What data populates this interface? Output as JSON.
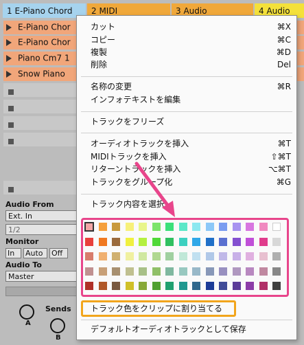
{
  "tracks": [
    {
      "label": "1 E-Piano Chord",
      "color": "#a6d3ee"
    },
    {
      "label": "2 MIDI",
      "color": "#f0a83a"
    },
    {
      "label": "3 Audio",
      "color": "#f0a83a"
    },
    {
      "label": "4 Audio",
      "color": "#f4e13a"
    }
  ],
  "clips": [
    "E-Piano Chor",
    "E-Piano Chor",
    "Piano Cm7 1",
    "Snow Piano"
  ],
  "panel": {
    "audio_from_label": "Audio From",
    "audio_from_value": "Ext. In",
    "input_channel": "1/2",
    "monitor_label": "Monitor",
    "monitor_in": "In",
    "monitor_auto": "Auto",
    "monitor_off": "Off",
    "audio_to_label": "Audio To",
    "audio_to_value": "Master",
    "sends_label": "Sends",
    "send_a": "A",
    "send_b": "B"
  },
  "menu": {
    "items": [
      {
        "label": "カット",
        "shortcut": "⌘X"
      },
      {
        "label": "コピー",
        "shortcut": "⌘C"
      },
      {
        "label": "複製",
        "shortcut": "⌘D"
      },
      {
        "label": "削除",
        "shortcut": "Del"
      },
      {
        "label": "名称の変更",
        "shortcut": "⌘R"
      },
      {
        "label": "インフォテキストを編集",
        "shortcut": ""
      },
      {
        "label": "トラックをフリーズ",
        "shortcut": ""
      },
      {
        "label": "オーディオトラックを挿入",
        "shortcut": "⌘T"
      },
      {
        "label": "MIDIトラックを挿入",
        "shortcut": "⇧⌘T"
      },
      {
        "label": "リターントラックを挿入",
        "shortcut": "⌥⌘T"
      },
      {
        "label": "トラックをグループ化",
        "shortcut": "⌘G"
      },
      {
        "label": "トラック内容を選択",
        "shortcut": ""
      },
      {
        "label": "トラック色をクリップに割り当てる",
        "shortcut": ""
      },
      {
        "label": "デフォルトオーディオトラックとして保存",
        "shortcut": ""
      }
    ],
    "palette": [
      [
        "#f2a6a6",
        "#f5a03c",
        "#c99a3c",
        "#f7f07a",
        "#e8f58a",
        "#7ce46a",
        "#3ce07a",
        "#5ce8c8",
        "#8ce8f0",
        "#8cc8f8",
        "#7a9cf0",
        "#a893f0",
        "#d876e0",
        "#f08ac0",
        "#ffffff"
      ],
      [
        "#e8403c",
        "#f07820",
        "#9a6a3c",
        "#f0f040",
        "#b4f040",
        "#50d838",
        "#30c060",
        "#3cd0c0",
        "#30a8e8",
        "#2070c8",
        "#5a70d0",
        "#8450d0",
        "#c050d8",
        "#e03c8c",
        "#d8d8d8"
      ],
      [
        "#d87c6c",
        "#f0b070",
        "#d0b070",
        "#f0f0a0",
        "#d0e8a0",
        "#b0d890",
        "#a0d0a0",
        "#c0e8d8",
        "#c0e0f0",
        "#b0c8e8",
        "#c0b8e8",
        "#c8b0e8",
        "#e0b0e0",
        "#e8c0d0",
        "#b0b0b0"
      ],
      [
        "#c09090",
        "#c8a078",
        "#a89070",
        "#c0c090",
        "#a8c088",
        "#90c068",
        "#80b8a0",
        "#98c8c0",
        "#98b8c8",
        "#8898b8",
        "#9890c0",
        "#b098c0",
        "#b888c0",
        "#c088a0",
        "#888888"
      ],
      [
        "#b03028",
        "#b05828",
        "#7a5a40",
        "#d0c028",
        "#88a838",
        "#50a030",
        "#20a070",
        "#209890",
        "#30688c",
        "#1c3c98",
        "#404c98",
        "#5c3c98",
        "#8c3ca8",
        "#b03068",
        "#404040"
      ]
    ]
  }
}
